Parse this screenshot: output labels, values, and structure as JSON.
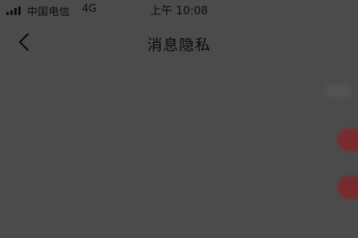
{
  "status_bar": {
    "carrier": "中国电信",
    "network": "4G",
    "time": "上午 10:08"
  },
  "nav": {
    "title": "消息隐私",
    "back_icon": "chevron-left-icon"
  },
  "settings": {
    "items": [
      {
        "label": "",
        "control": "value"
      },
      {
        "label": "",
        "control": "toggle",
        "on": true
      },
      {
        "label": "",
        "control": "toggle",
        "on": true
      }
    ]
  },
  "colors": {
    "overlay_background": "#4b4b4b",
    "text_dark": "#0a0a0a",
    "toggle_on": "#7a2a2c"
  }
}
